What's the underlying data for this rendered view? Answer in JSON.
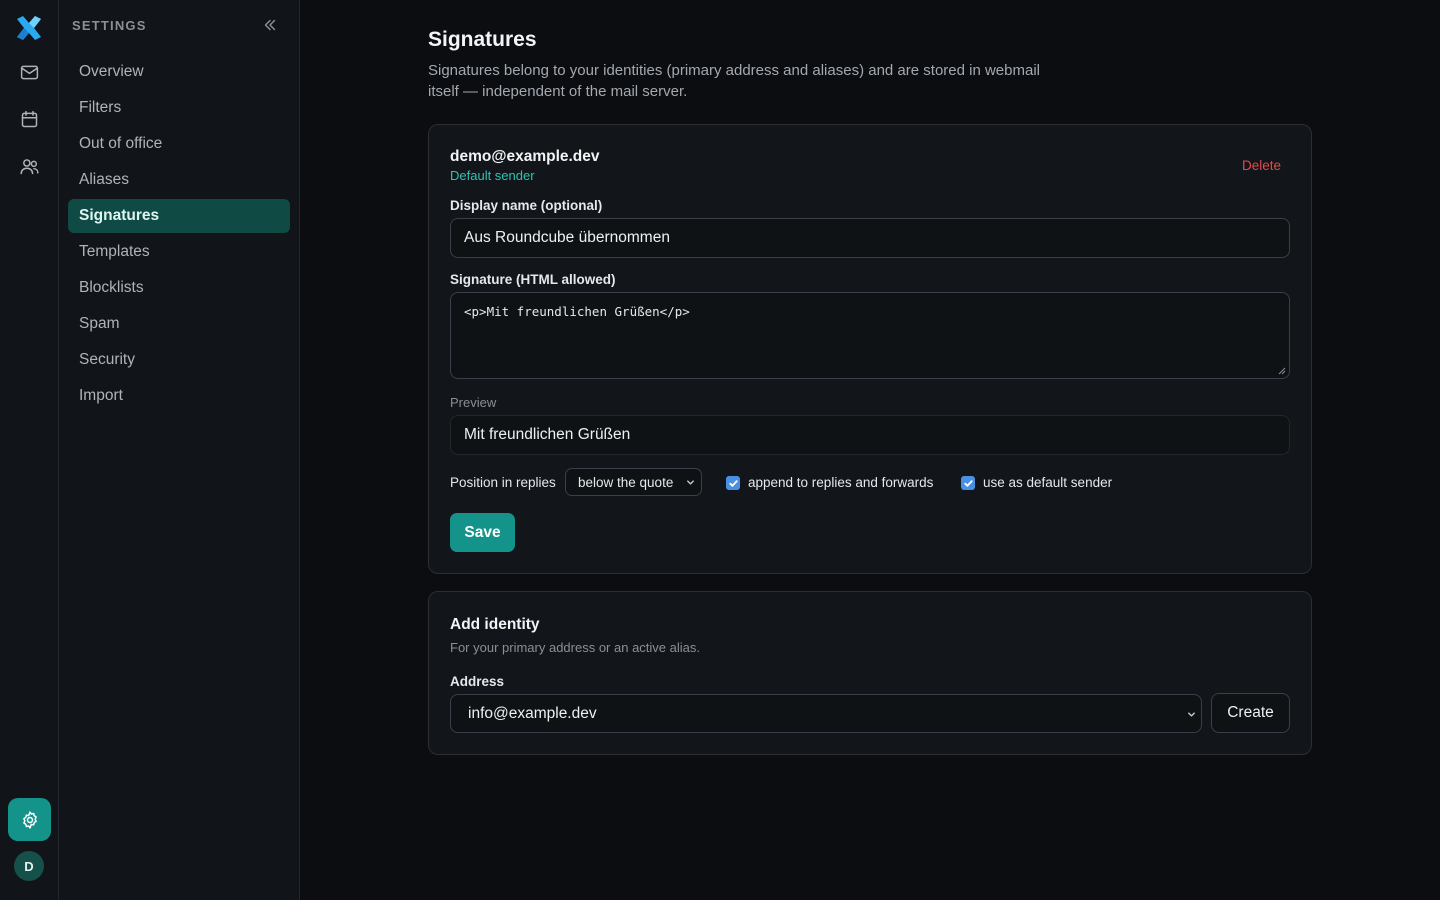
{
  "rail": {
    "logo_icon": "x-logo-icon",
    "items": [
      {
        "name": "mail",
        "icon": "mail-icon"
      },
      {
        "name": "calendar",
        "icon": "calendar-icon"
      },
      {
        "name": "contacts",
        "icon": "users-icon"
      }
    ],
    "settings_icon": "gear-icon",
    "avatar_initial": "D",
    "accent": "#14938a"
  },
  "sidebar": {
    "title": "SETTINGS",
    "items": [
      {
        "label": "Overview",
        "active": false
      },
      {
        "label": "Filters",
        "active": false
      },
      {
        "label": "Out of office",
        "active": false
      },
      {
        "label": "Aliases",
        "active": false
      },
      {
        "label": "Signatures",
        "active": true
      },
      {
        "label": "Templates",
        "active": false
      },
      {
        "label": "Blocklists",
        "active": false
      },
      {
        "label": "Spam",
        "active": false
      },
      {
        "label": "Security",
        "active": false
      },
      {
        "label": "Import",
        "active": false
      }
    ]
  },
  "main": {
    "title": "Signatures",
    "description": "Signatures belong to your identities (primary address and aliases) and are stored in webmail itself — independent of the mail server."
  },
  "identity": {
    "email": "demo@example.dev",
    "tag": "Default sender",
    "delete_label": "Delete",
    "display_name_label": "Display name (optional)",
    "display_name_value": "Aus Roundcube übernommen",
    "signature_label": "Signature (HTML allowed)",
    "signature_value": "<p>Mit freundlichen Grüßen</p>",
    "preview_label": "Preview",
    "preview_text": "Mit freundlichen Grüßen",
    "position_label": "Position in replies",
    "position_value": "below the quote",
    "append_label": "append to replies and forwards",
    "append_checked": true,
    "default_label": "use as default sender",
    "default_checked": true,
    "save_label": "Save"
  },
  "add_identity": {
    "title": "Add identity",
    "description": "For your primary address or an active alias.",
    "address_label": "Address",
    "address_value": "info@example.dev",
    "create_label": "Create"
  },
  "colors": {
    "accent": "#14938a",
    "accent_text": "#2fc3b2",
    "danger": "#e5484d",
    "checkbox": "#4a90e2"
  }
}
